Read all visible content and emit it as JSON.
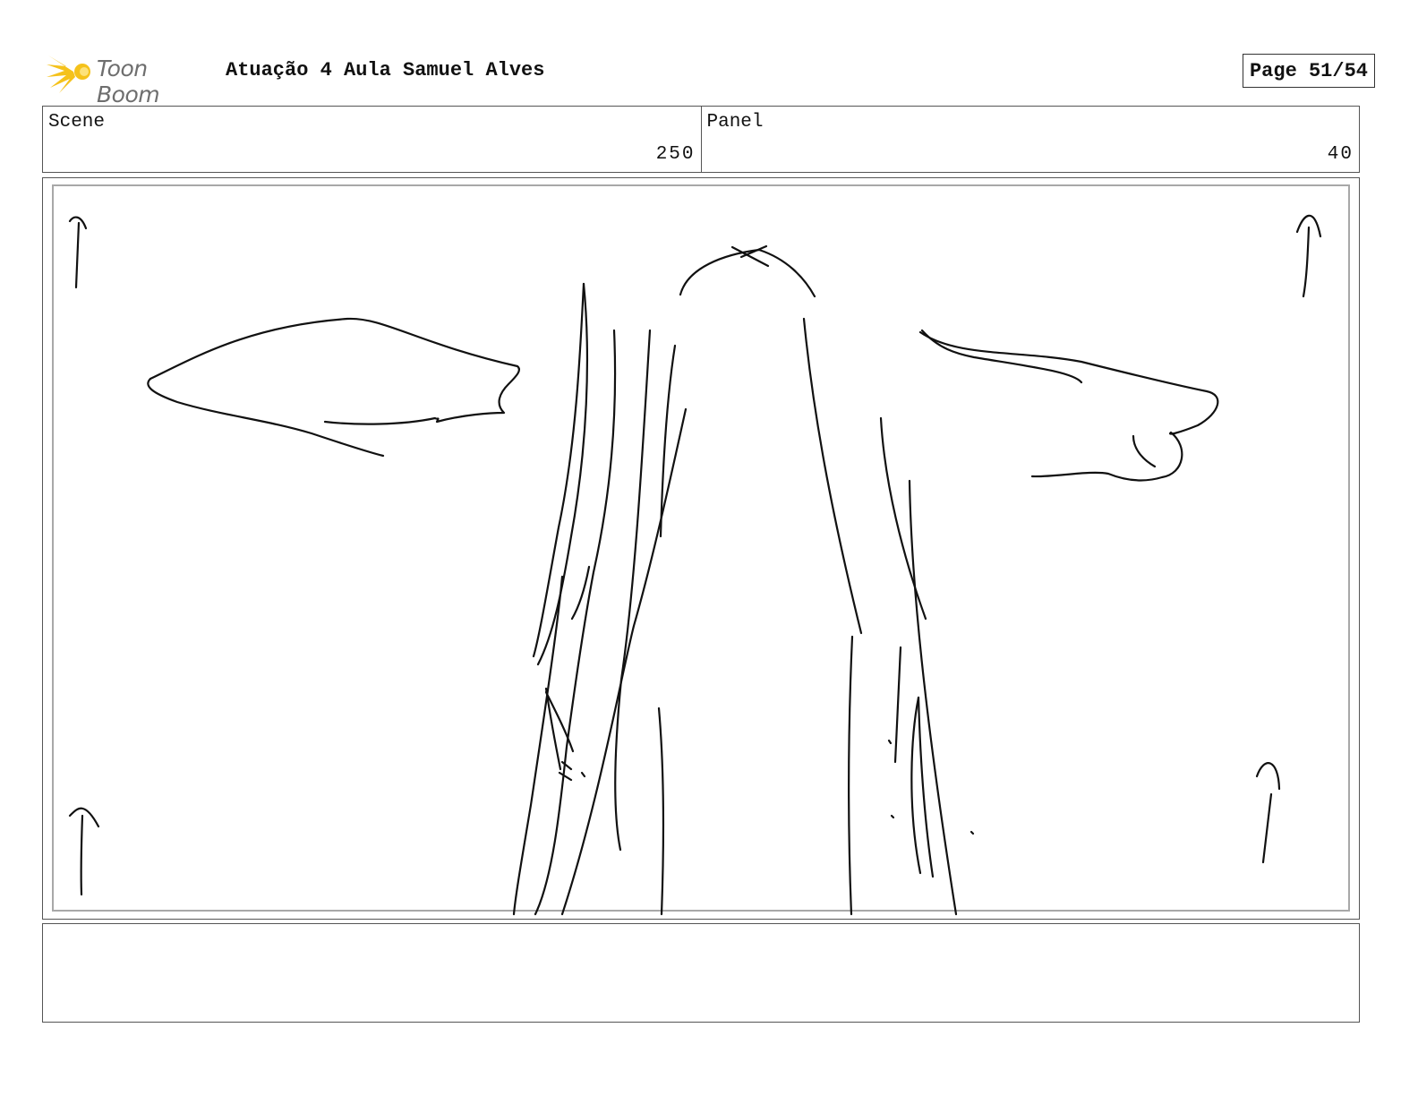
{
  "header": {
    "logo_text": "Toon Boom",
    "title": "Atuação 4 Aula Samuel Alves",
    "page_label": "Page 51/54"
  },
  "info": {
    "scene_label": "Scene",
    "scene_value": "250",
    "panel_label": "Panel",
    "panel_value": "40"
  },
  "panel": {
    "sketch_description_icon": "storyboard-sketch"
  },
  "notes": {
    "text": ""
  },
  "colors": {
    "logo_yellow": "#f5c21b",
    "logo_text": "#6e6e6e",
    "border": "#555555",
    "safe_area": "#a8a8a8"
  }
}
